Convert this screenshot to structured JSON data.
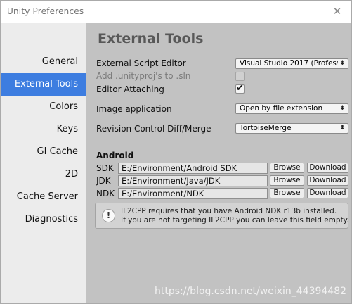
{
  "window": {
    "title": "Unity Preferences",
    "close_glyph": "✕"
  },
  "sidebar": {
    "items": [
      {
        "label": "General",
        "active": false
      },
      {
        "label": "External Tools",
        "active": true
      },
      {
        "label": "Colors",
        "active": false
      },
      {
        "label": "Keys",
        "active": false
      },
      {
        "label": "GI Cache",
        "active": false
      },
      {
        "label": "2D",
        "active": false
      },
      {
        "label": "Cache Server",
        "active": false
      },
      {
        "label": "Diagnostics",
        "active": false
      }
    ]
  },
  "main": {
    "heading": "External Tools",
    "external_script_editor": {
      "label": "External Script Editor",
      "value": "Visual Studio 2017 (Profess"
    },
    "add_unityproj": {
      "label": "Add .unityproj's to .sln",
      "checked": false,
      "enabled": false
    },
    "editor_attaching": {
      "label": "Editor Attaching",
      "checked": true
    },
    "image_application": {
      "label": "Image application",
      "value": "Open by file extension"
    },
    "revision_control": {
      "label": "Revision Control Diff/Merge",
      "value": "TortoiseMerge"
    },
    "dropdown_arrow": "⬍",
    "check_glyph": "✔",
    "android": {
      "title": "Android",
      "browse_label": "Browse",
      "download_label": "Download",
      "sdk": {
        "label": "SDK",
        "path": "E:/Environment/Android SDK"
      },
      "jdk": {
        "label": "JDK",
        "path": "E:/Environment/Java/JDK"
      },
      "ndk": {
        "label": "NDK",
        "path": "E:/Environment/NDK"
      }
    },
    "info": {
      "icon": "!",
      "line1": "IL2CPP requires that you have Android NDK r13b installed.",
      "line2": "If you are not targeting IL2CPP you can leave this field empty."
    }
  },
  "watermark": "https://blog.csdn.net/weixin_44394482",
  "colors": {
    "accent": "#3d7de0",
    "content_bg": "#c2c2c2",
    "sidebar_bg": "#ececec"
  }
}
